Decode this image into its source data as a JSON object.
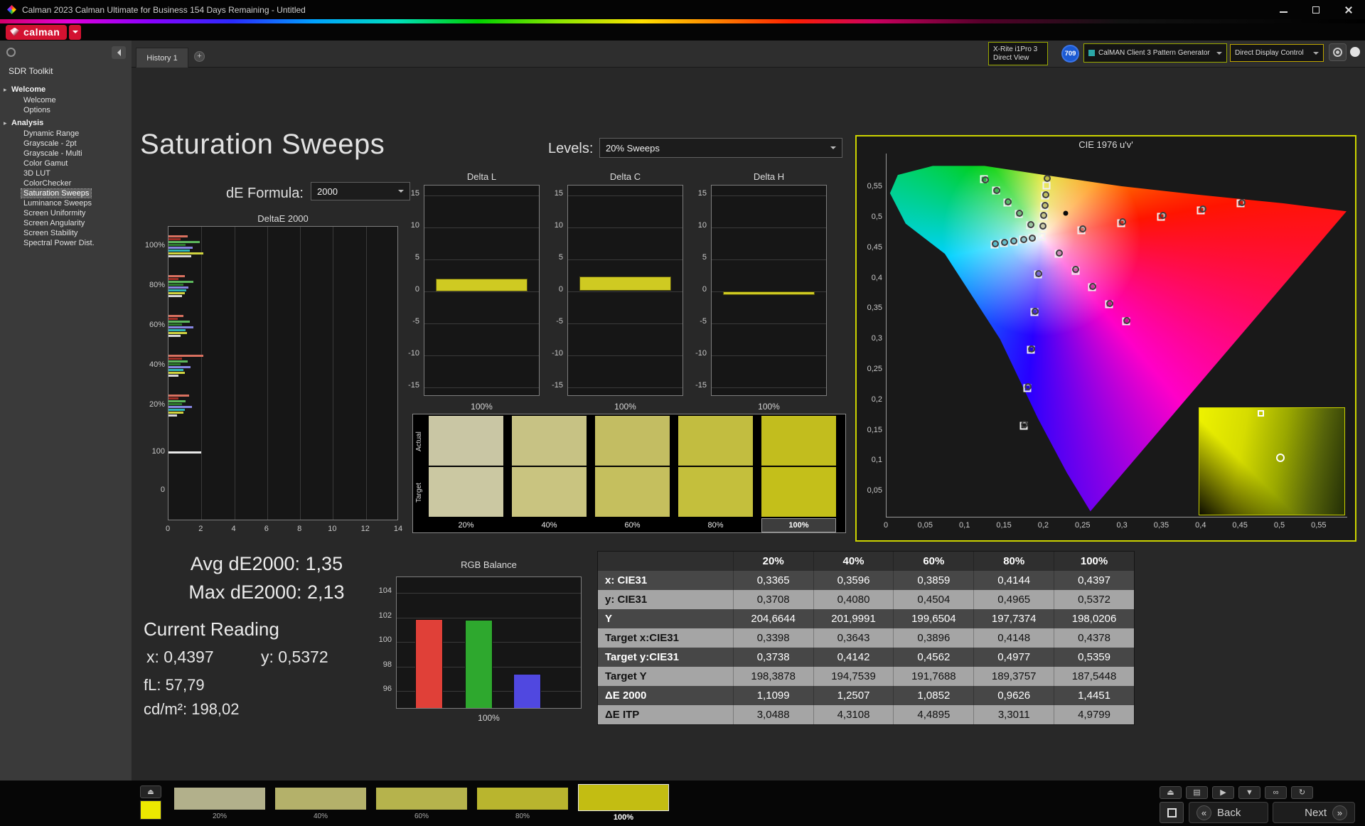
{
  "titlebar": {
    "title": "Calman 2023 Calman Ultimate for Business 154 Days Remaining  - Untitled"
  },
  "brand": {
    "name": "calman"
  },
  "tabs": {
    "active": "History 1"
  },
  "devices": {
    "meter": {
      "line1": "X-Rite i1Pro 3",
      "line2": "Direct View"
    },
    "badge": "709",
    "source": "CalMAN Client 3 Pattern Generator",
    "display_control": "Direct Display Control"
  },
  "sidebar": {
    "workflow": "SDR Toolkit",
    "selected": "Saturation Sweeps",
    "sections": [
      {
        "label": "Welcome",
        "items": [
          "Welcome",
          "Options"
        ]
      },
      {
        "label": "Analysis",
        "items": [
          "Dynamic Range",
          "Grayscale - 2pt",
          "Grayscale - Multi",
          "Color Gamut",
          "3D LUT",
          "ColorChecker",
          "Saturation Sweeps",
          "Luminance Sweeps",
          "Screen Uniformity",
          "Screen Angularity",
          "Screen Stability",
          "Spectral Power Dist."
        ]
      }
    ]
  },
  "page": {
    "title": "Saturation Sweeps",
    "de_formula_label": "dE Formula:",
    "de_formula_value": "2000",
    "levels_label": "Levels:",
    "levels_value": "20% Sweeps"
  },
  "stats": {
    "avg": "Avg dE2000: 1,35",
    "max": "Max dE2000: 2,13",
    "current_heading": "Current Reading",
    "x": "x: 0,4397",
    "y": "y: 0,5372",
    "fl": "fL: 57,79",
    "cd": "cd/m²: 198,02"
  },
  "chart_data": [
    {
      "id": "deltae2000",
      "type": "bar",
      "orientation": "horizontal",
      "title": "DeltaE 2000",
      "xlim": [
        0,
        14
      ],
      "xticks": [
        0,
        2,
        4,
        6,
        8,
        10,
        12,
        14
      ],
      "groups": [
        {
          "label": "100%",
          "pos": 0.068,
          "bars": [
            {
              "color": "#d9705f",
              "v": 1.15
            },
            {
              "color": "#9c2d24",
              "v": 0.72
            },
            {
              "color": "#5cb85c",
              "v": 1.92
            },
            {
              "color": "#2c7a2c",
              "v": 1.05
            },
            {
              "color": "#8585e0",
              "v": 1.48
            },
            {
              "color": "#2db4b4",
              "v": 1.3
            },
            {
              "color": "#cfd23e",
              "v": 2.13
            },
            {
              "color": "#d8d8d8",
              "v": 1.4
            }
          ]
        },
        {
          "label": "80%",
          "pos": 0.203,
          "bars": [
            {
              "color": "#d9705f",
              "v": 1.0
            },
            {
              "color": "#9c2d24",
              "v": 0.62
            },
            {
              "color": "#5cb85c",
              "v": 1.52
            },
            {
              "color": "#2c7a2c",
              "v": 0.9
            },
            {
              "color": "#8585e0",
              "v": 1.22
            },
            {
              "color": "#2db4b4",
              "v": 1.08
            },
            {
              "color": "#cfd23e",
              "v": 1.0
            },
            {
              "color": "#d8d8d8",
              "v": 0.82
            }
          ]
        },
        {
          "label": "60%",
          "pos": 0.338,
          "bars": [
            {
              "color": "#d9705f",
              "v": 0.92
            },
            {
              "color": "#9c2d24",
              "v": 0.55
            },
            {
              "color": "#5cb85c",
              "v": 1.3
            },
            {
              "color": "#2c7a2c",
              "v": 0.82
            },
            {
              "color": "#8585e0",
              "v": 1.52
            },
            {
              "color": "#2db4b4",
              "v": 1.02
            },
            {
              "color": "#cfd23e",
              "v": 1.12
            },
            {
              "color": "#d8d8d8",
              "v": 0.72
            }
          ]
        },
        {
          "label": "40%",
          "pos": 0.473,
          "bars": [
            {
              "color": "#d9705f",
              "v": 2.1
            },
            {
              "color": "#9c2d24",
              "v": 0.8
            },
            {
              "color": "#5cb85c",
              "v": 1.18
            },
            {
              "color": "#2c7a2c",
              "v": 0.72
            },
            {
              "color": "#8585e0",
              "v": 1.32
            },
            {
              "color": "#2db4b4",
              "v": 0.92
            },
            {
              "color": "#cfd23e",
              "v": 1.0
            },
            {
              "color": "#d8d8d8",
              "v": 0.62
            }
          ]
        },
        {
          "label": "20%",
          "pos": 0.608,
          "bars": [
            {
              "color": "#d9705f",
              "v": 1.25
            },
            {
              "color": "#9c2d24",
              "v": 0.6
            },
            {
              "color": "#5cb85c",
              "v": 1.02
            },
            {
              "color": "#2c7a2c",
              "v": 0.82
            },
            {
              "color": "#8585e0",
              "v": 1.42
            },
            {
              "color": "#2db4b4",
              "v": 1.0
            },
            {
              "color": "#cfd23e",
              "v": 0.9
            },
            {
              "color": "#d8d8d8",
              "v": 0.52
            }
          ]
        },
        {
          "label": "100",
          "pos": 0.768,
          "bars": [
            {
              "color": "#e8e8e8",
              "v": 2.0
            }
          ]
        },
        {
          "label": "0",
          "pos": 0.898,
          "bars": []
        }
      ]
    },
    {
      "id": "deltaL",
      "type": "bar",
      "title": "Delta L",
      "ylim": [
        -15,
        15
      ],
      "yticks": [
        15,
        10,
        5,
        0,
        -5,
        -10,
        -15
      ],
      "value": 2.0,
      "bar_color": "#cfca22",
      "xlabel": "100%"
    },
    {
      "id": "deltaC",
      "type": "bar",
      "title": "Delta C",
      "ylim": [
        -15,
        15
      ],
      "yticks": [
        15,
        10,
        5,
        0,
        -5,
        -10,
        -15
      ],
      "value": 2.3,
      "bar_color": "#cfca22",
      "xlabel": "100%"
    },
    {
      "id": "deltaH",
      "type": "bar",
      "title": "Delta H",
      "ylim": [
        -15,
        15
      ],
      "yticks": [
        15,
        10,
        5,
        0,
        -5,
        -10,
        -15
      ],
      "value": -0.6,
      "bar_color": "#cfca22",
      "xlabel": "100%"
    },
    {
      "id": "rgb_balance",
      "type": "bar",
      "title": "RGB Balance",
      "xlabel": "100%",
      "ylim": [
        94.5,
        105.3
      ],
      "yticks": [
        104,
        102,
        100,
        98,
        96
      ],
      "series": [
        {
          "name": "Red",
          "color": "#e04038",
          "value": 101.9
        },
        {
          "name": "Green",
          "color": "#2ea82e",
          "value": 101.8
        },
        {
          "name": "Blue",
          "color": "#5048e0",
          "value": 97.4
        }
      ]
    },
    {
      "id": "cie",
      "type": "scatter",
      "title": "CIE 1976 u'v'",
      "xticks": [
        "0",
        "0,05",
        "0,1",
        "0,15",
        "0,2",
        "0,25",
        "0,3",
        "0,35",
        "0,4",
        "0,45",
        "0,5",
        "0,55"
      ],
      "yticks": [
        "0,05",
        "0,1",
        "0,15",
        "0,2",
        "0,25",
        "0,3",
        "0,35",
        "0,4",
        "0,45",
        "0,5",
        "0,55"
      ],
      "targets": [
        [
          0.1978,
          0.4683
        ],
        [
          0.2484,
          0.4792
        ],
        [
          0.299,
          0.4901
        ],
        [
          0.3495,
          0.5011
        ],
        [
          0.4001,
          0.512
        ],
        [
          0.4507,
          0.5229
        ],
        [
          0.1832,
          0.4871
        ],
        [
          0.1687,
          0.506
        ],
        [
          0.1541,
          0.5248
        ],
        [
          0.1396,
          0.5437
        ],
        [
          0.125,
          0.5625
        ],
        [
          0.1933,
          0.4062
        ],
        [
          0.1888,
          0.3441
        ],
        [
          0.1844,
          0.2821
        ],
        [
          0.1799,
          0.22
        ],
        [
          0.1754,
          0.1579
        ],
        [
          0.1859,
          0.4658
        ],
        [
          0.1741,
          0.4633
        ],
        [
          0.1622,
          0.4607
        ],
        [
          0.1504,
          0.4582
        ],
        [
          0.1385,
          0.4557
        ],
        [
          0.2193,
          0.4405
        ],
        [
          0.2408,
          0.4128
        ],
        [
          0.2623,
          0.385
        ],
        [
          0.2838,
          0.3573
        ],
        [
          0.3053,
          0.3295
        ],
        [
          0.199,
          0.4852
        ],
        [
          0.2002,
          0.5021
        ],
        [
          0.2015,
          0.519
        ],
        [
          0.2027,
          0.5359
        ],
        [
          0.2039,
          0.5528
        ]
      ],
      "measurements": [
        [
          0.25,
          0.481
        ],
        [
          0.301,
          0.4925
        ],
        [
          0.352,
          0.503
        ],
        [
          0.403,
          0.5135
        ],
        [
          0.453,
          0.5245
        ],
        [
          0.1845,
          0.488
        ],
        [
          0.17,
          0.5068
        ],
        [
          0.1556,
          0.5255
        ],
        [
          0.141,
          0.544
        ],
        [
          0.1268,
          0.562
        ],
        [
          0.194,
          0.4075
        ],
        [
          0.1896,
          0.3455
        ],
        [
          0.1852,
          0.2835
        ],
        [
          0.1808,
          0.2215
        ],
        [
          0.1763,
          0.1595
        ],
        [
          0.1865,
          0.4665
        ],
        [
          0.1748,
          0.464
        ],
        [
          0.163,
          0.4615
        ],
        [
          0.1512,
          0.459
        ],
        [
          0.1393,
          0.4565
        ],
        [
          0.22,
          0.4415
        ],
        [
          0.2415,
          0.414
        ],
        [
          0.263,
          0.3862
        ],
        [
          0.2845,
          0.3585
        ],
        [
          0.306,
          0.3308
        ],
        [
          0.1995,
          0.486
        ],
        [
          0.2008,
          0.503
        ],
        [
          0.202,
          0.52
        ],
        [
          0.2032,
          0.537
        ],
        [
          0.2053,
          0.5644
        ]
      ],
      "reference_dot": [
        0.2286,
        0.507
      ]
    }
  ],
  "swatch_panel": {
    "row_labels": [
      "Actual",
      "Target"
    ],
    "levels": [
      {
        "label": "20%",
        "actual": "#c9c6a4",
        "target": "#cbc8a2"
      },
      {
        "label": "40%",
        "actual": "#c7c284",
        "target": "#c9c480"
      },
      {
        "label": "60%",
        "actual": "#c3bd62",
        "target": "#c5bf5e"
      },
      {
        "label": "80%",
        "actual": "#c2bd40",
        "target": "#c4bf3c"
      },
      {
        "label": "100%",
        "actual": "#c2bd1e",
        "target": "#c4bf1a"
      }
    ]
  },
  "table": {
    "headers": [
      "20%",
      "40%",
      "60%",
      "80%",
      "100%"
    ],
    "rows": [
      {
        "label": "x: CIE31",
        "values": [
          "0,3365",
          "0,3596",
          "0,3859",
          "0,4144",
          "0,4397"
        ]
      },
      {
        "label": "y: CIE31",
        "values": [
          "0,3708",
          "0,4080",
          "0,4504",
          "0,4965",
          "0,5372"
        ]
      },
      {
        "label": "Y",
        "values": [
          "204,6644",
          "201,9991",
          "199,6504",
          "197,7374",
          "198,0206"
        ]
      },
      {
        "label": "Target x:CIE31",
        "values": [
          "0,3398",
          "0,3643",
          "0,3896",
          "0,4148",
          "0,4378"
        ]
      },
      {
        "label": "Target y:CIE31",
        "values": [
          "0,3738",
          "0,4142",
          "0,4562",
          "0,4977",
          "0,5359"
        ]
      },
      {
        "label": "Target Y",
        "values": [
          "198,3878",
          "194,7539",
          "191,7688",
          "189,3757",
          "187,5448"
        ]
      },
      {
        "label": "ΔE 2000",
        "values": [
          "1,1099",
          "1,2507",
          "1,0852",
          "0,9626",
          "1,4451"
        ]
      },
      {
        "label": "ΔE ITP",
        "values": [
          "3,0488",
          "4,3108",
          "4,4895",
          "3,3011",
          "4,9799"
        ]
      }
    ]
  },
  "bottombar": {
    "eject_icon": "⏏",
    "current_color": "#ece800",
    "patches": [
      {
        "label": "20%",
        "color": "#b2b08b"
      },
      {
        "label": "40%",
        "color": "#b4b16a"
      },
      {
        "label": "60%",
        "color": "#b6b34c"
      },
      {
        "label": "80%",
        "color": "#b9b52e"
      },
      {
        "label": "100%",
        "color": "#c3bd12",
        "selected": true
      }
    ],
    "transport_icons": [
      {
        "name": "eject",
        "glyph": "⏏"
      },
      {
        "name": "pattern-screen",
        "glyph": "▤"
      },
      {
        "name": "play",
        "glyph": "▶"
      },
      {
        "name": "download",
        "glyph": "▼"
      },
      {
        "name": "continuous-read",
        "glyph": "∞"
      },
      {
        "name": "reset",
        "glyph": "↻"
      }
    ],
    "back_icon": "«",
    "back_label": "Back",
    "next_label": "Next",
    "next_icon": "»"
  }
}
